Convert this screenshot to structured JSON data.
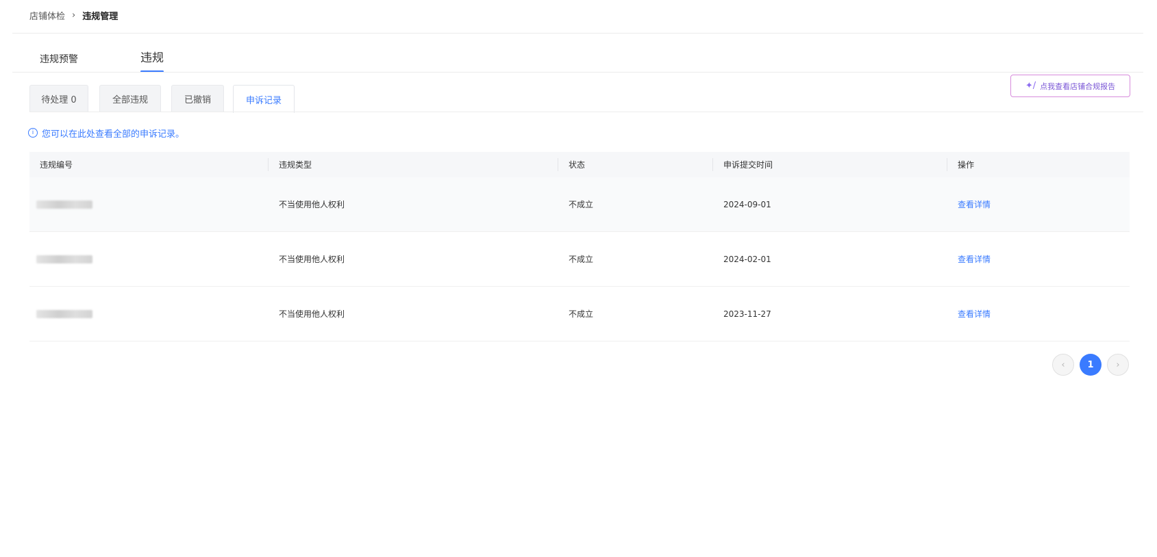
{
  "breadcrumb": {
    "items": [
      "店铺体检",
      "违规管理"
    ],
    "separator": "›"
  },
  "main_tabs": [
    {
      "label": "违规预警",
      "active": false
    },
    {
      "label": "违规",
      "active": true
    }
  ],
  "sub_tabs": [
    {
      "label": "待处理 0",
      "active": false
    },
    {
      "label": "全部违规",
      "active": false
    },
    {
      "label": "已撤销",
      "active": false
    },
    {
      "label": "申诉记录",
      "active": true
    }
  ],
  "report_button": {
    "icon": "magic-wand-icon",
    "label": "点我查看店铺合规报告"
  },
  "info": {
    "icon": "info-icon",
    "text": "您可以在此处查看全部的申诉记录。"
  },
  "table": {
    "columns": [
      "违规编号",
      "违规类型",
      "状态",
      "申诉提交时间",
      "操作"
    ],
    "rows": [
      {
        "id": "",
        "type": "不当使用他人权利",
        "status": "不成立",
        "time": "2024-09-01",
        "action": "查看详情"
      },
      {
        "id": "",
        "type": "不当使用他人权利",
        "status": "不成立",
        "time": "2024-02-01",
        "action": "查看详情"
      },
      {
        "id": "",
        "type": "不当使用他人权利",
        "status": "不成立",
        "time": "2023-11-27",
        "action": "查看详情"
      }
    ]
  },
  "pagination": {
    "prev": "‹",
    "current": "1",
    "next": "›"
  },
  "colors": {
    "accent": "#3a7bff",
    "report_border": "#d78bdc",
    "report_text": "#7a56d6"
  }
}
